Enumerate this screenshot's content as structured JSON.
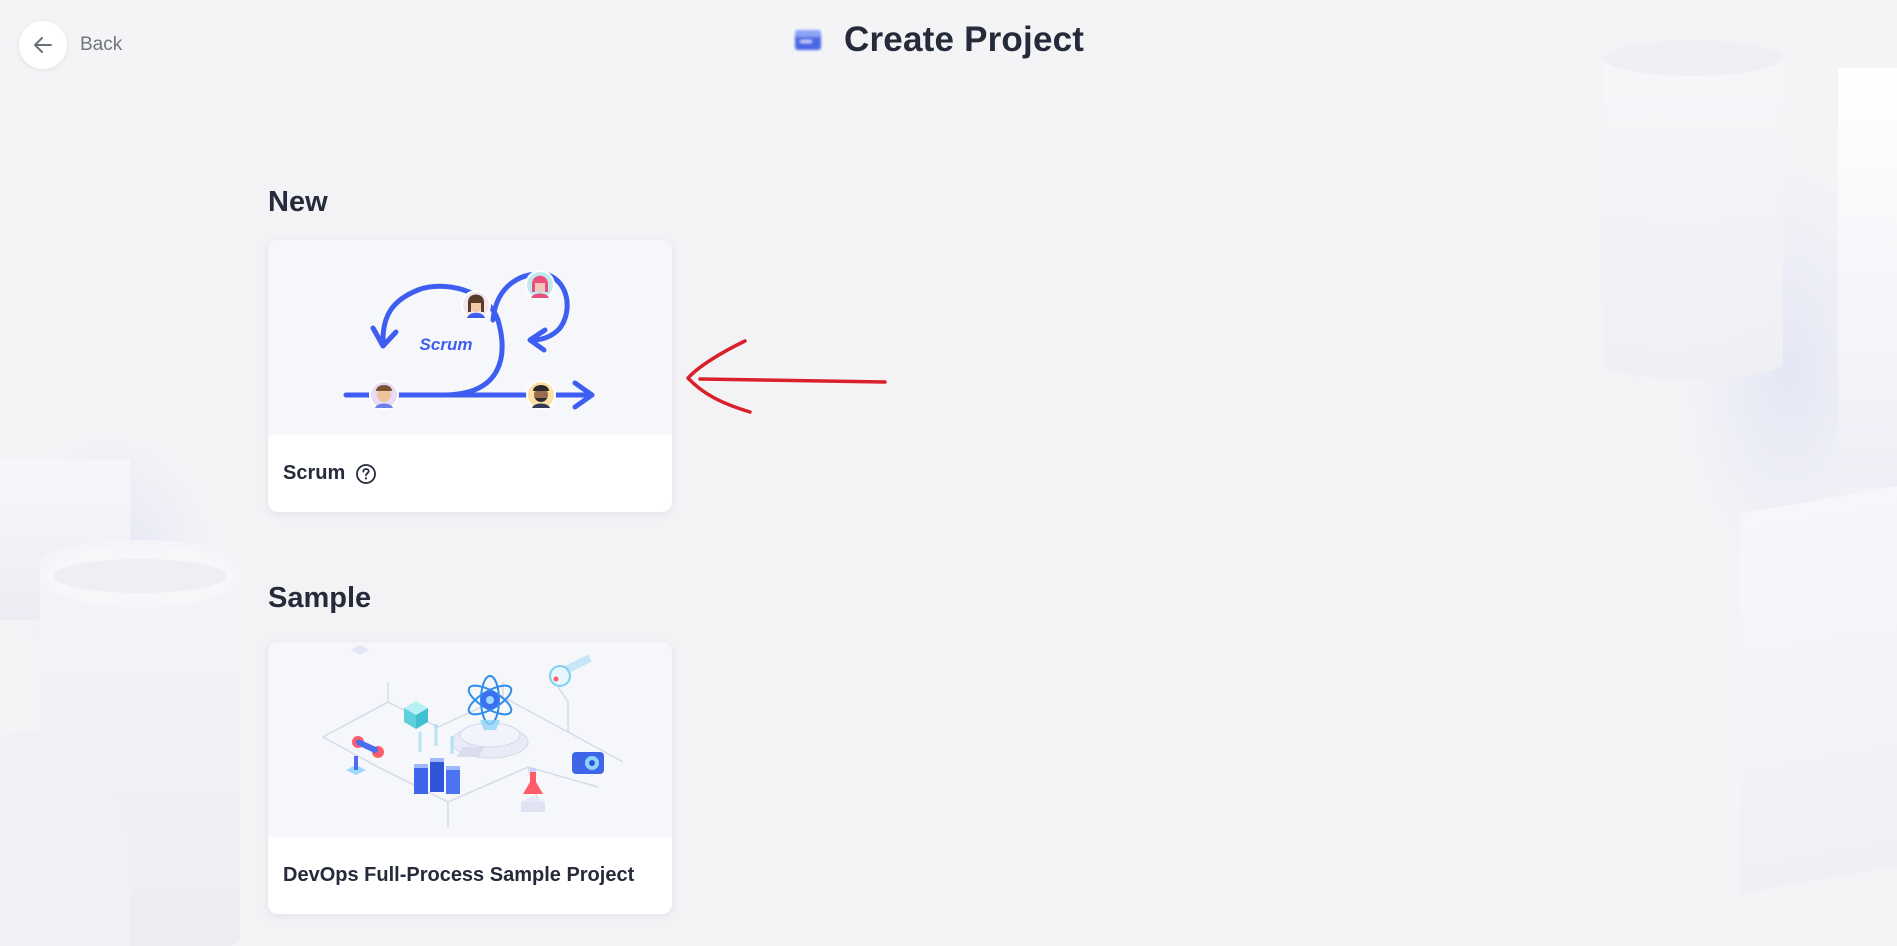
{
  "header": {
    "back_label": "Back",
    "title": "Create Project"
  },
  "sections": [
    {
      "title": "New",
      "cards": [
        {
          "label": "Scrum",
          "illustration_text": "Scrum",
          "has_help_icon": true
        }
      ]
    },
    {
      "title": "Sample",
      "cards": [
        {
          "label": "DevOps Full-Process Sample Project",
          "has_help_icon": false
        }
      ]
    }
  ],
  "icons": {
    "back": "arrow-left-icon",
    "title": "project-icon",
    "help": "help-circle-icon",
    "annotation": "red-arrow-annotation"
  },
  "colors": {
    "accent": "#3d5ef0",
    "text": "#252b3a",
    "muted": "#71757f",
    "annotation": "#d8202a",
    "background": "#f4f4f7"
  }
}
